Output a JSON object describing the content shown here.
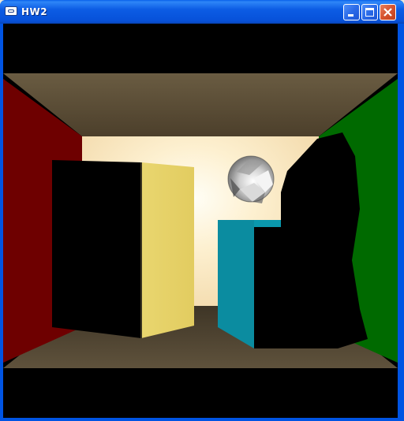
{
  "window": {
    "title": "HW2",
    "icons": {
      "app": "app-window-icon",
      "minimize": "minimize-icon",
      "maximize": "maximize-icon",
      "close": "close-icon"
    }
  },
  "scene": {
    "colors": {
      "background": "#000000",
      "ceiling": "#5e5038",
      "floor": "#5a4d38",
      "left_wall": "#6e0000",
      "right_wall": "#006a00",
      "back_light_center": "#fffdf2",
      "back_light_edge": "#f2d8a6",
      "yellow_box": "#e6d26a",
      "teal_box": "#0b8ca0",
      "sphere": "#bdbdbd"
    }
  }
}
